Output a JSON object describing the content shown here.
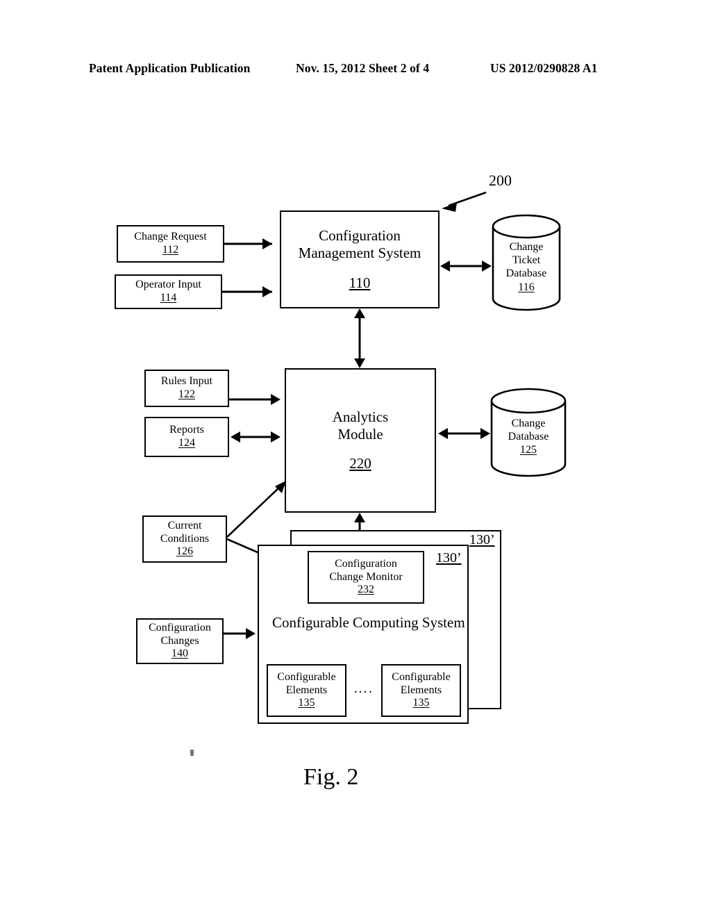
{
  "header": {
    "publication": "Patent Application Publication",
    "date_sheet": "Nov. 15, 2012  Sheet 2 of 4",
    "patent_number": "US 2012/0290828 A1"
  },
  "figure": {
    "caption": "Fig. 2",
    "system_ref": "200"
  },
  "nodes": {
    "change_request": {
      "label": "Change Request",
      "ref": "112"
    },
    "operator_input": {
      "label": "Operator Input",
      "ref": "114"
    },
    "config_mgmt_system": {
      "label_line1": "Configuration",
      "label_line2": "Management System",
      "ref": "110"
    },
    "change_ticket_db": {
      "label_line1": "Change",
      "label_line2": "Ticket",
      "label_line3": "Database",
      "ref": "116"
    },
    "rules_input": {
      "label": "Rules Input",
      "ref": "122"
    },
    "reports": {
      "label": "Reports",
      "ref": "124"
    },
    "analytics_module": {
      "label_line1": "Analytics",
      "label_line2": "Module",
      "ref": "220"
    },
    "change_db": {
      "label_line1": "Change",
      "label_line2": "Database",
      "ref": "125"
    },
    "current_conditions": {
      "label_line1": "Current",
      "label_line2": "Conditions",
      "ref": "126"
    },
    "configuration_changes": {
      "label_line1": "Configuration",
      "label_line2": "Changes",
      "ref": "140"
    },
    "config_change_monitor": {
      "label_line1": "Configuration",
      "label_line2": "Change Monitor",
      "ref": "232"
    },
    "configurable_computing_system": {
      "label": "Configurable Computing System",
      "ref_back": "130’",
      "ref_mid": "130’"
    },
    "configurable_elements_1": {
      "label_line1": "Configurable",
      "label_line2": "Elements",
      "ref": "135"
    },
    "configurable_elements_2": {
      "label_line1": "Configurable",
      "label_line2": "Elements",
      "ref": "135"
    },
    "elements_ellipsis": {
      "label": "…."
    }
  },
  "colors": {
    "ink": "#000000",
    "page": "#ffffff"
  }
}
